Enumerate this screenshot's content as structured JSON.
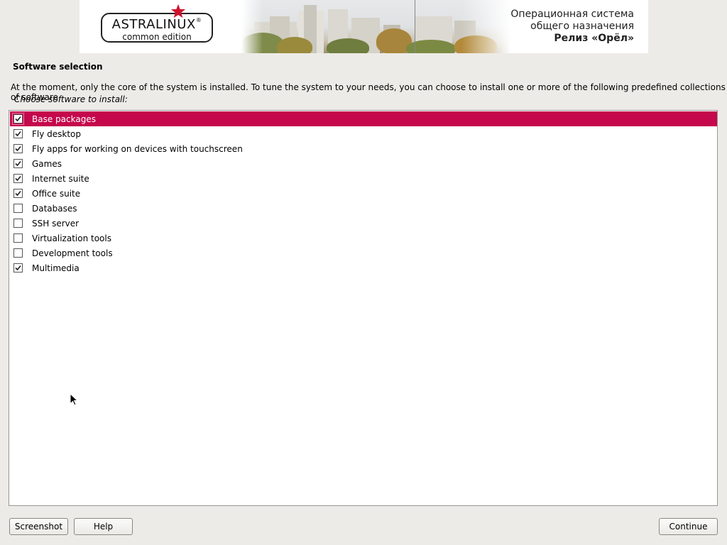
{
  "banner": {
    "logo_main": "ASTRALINUX",
    "logo_reg": "®",
    "logo_sub": "common edition",
    "os_line1": "Операционная система",
    "os_line2": "общего назначения",
    "release": "Релиз «Орёл»"
  },
  "page": {
    "title": "Software selection",
    "description": "At the moment, only the core of the system is installed. To tune the system to your needs, you can choose to install one or more of the following predefined collections of software.",
    "prompt": "Choose software to install:"
  },
  "software": [
    {
      "label": "Base packages",
      "checked": true,
      "selected": true
    },
    {
      "label": "Fly desktop",
      "checked": true,
      "selected": false
    },
    {
      "label": "Fly apps for working on devices with touchscreen",
      "checked": true,
      "selected": false
    },
    {
      "label": "Games",
      "checked": true,
      "selected": false
    },
    {
      "label": "Internet suite",
      "checked": true,
      "selected": false
    },
    {
      "label": "Office suite",
      "checked": true,
      "selected": false
    },
    {
      "label": "Databases",
      "checked": false,
      "selected": false
    },
    {
      "label": "SSH server",
      "checked": false,
      "selected": false
    },
    {
      "label": "Virtualization tools",
      "checked": false,
      "selected": false
    },
    {
      "label": "Development tools",
      "checked": false,
      "selected": false
    },
    {
      "label": "Multimedia",
      "checked": true,
      "selected": false
    }
  ],
  "buttons": {
    "screenshot": "Screenshot",
    "help": "Help",
    "continue": "Continue"
  },
  "colors": {
    "selection": "#c5074c",
    "star": "#d0112b",
    "background": "#edebe7"
  },
  "icons": {
    "checkbox_checked": "check-mark-icon",
    "logo": "red-star-icon",
    "pointer": "mouse-pointer-icon"
  }
}
